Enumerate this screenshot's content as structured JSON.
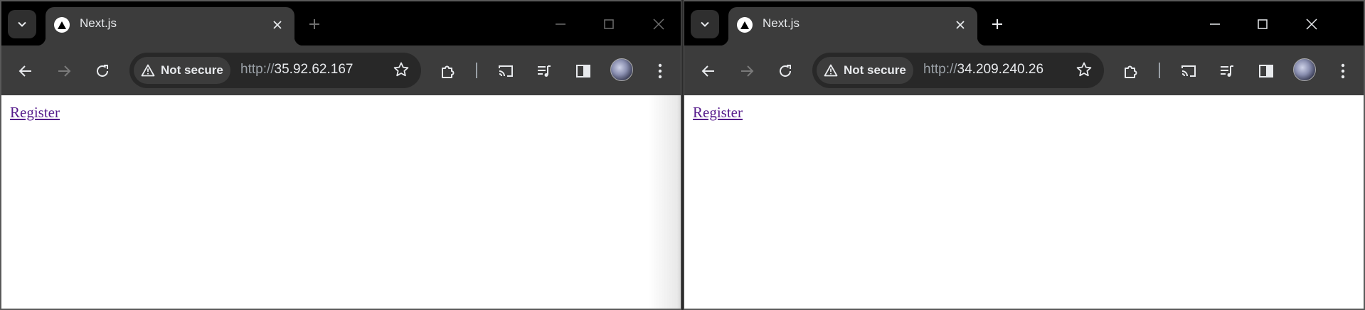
{
  "windows": [
    {
      "tab": {
        "title": "Next.js"
      },
      "address": {
        "security_label": "Not secure",
        "url_scheme": "http://",
        "url_host": "35.92.62.167"
      },
      "page": {
        "link_text": "Register"
      }
    },
    {
      "tab": {
        "title": "Next.js"
      },
      "address": {
        "security_label": "Not secure",
        "url_scheme": "http://",
        "url_host": "34.209.240.26"
      },
      "page": {
        "link_text": "Register"
      }
    }
  ],
  "icons": {
    "tab_search": "chevron-down-icon",
    "favicon": "nextjs-triangle-icon",
    "close": "close-icon",
    "new_tab": "plus-icon",
    "minimize": "minimize-icon",
    "maximize": "maximize-icon",
    "window_close": "window-close-icon",
    "back": "back-arrow-icon",
    "forward": "forward-arrow-icon",
    "reload": "reload-icon",
    "warning": "warning-triangle-icon",
    "bookmark": "star-icon",
    "extensions": "puzzle-icon",
    "cast": "cast-icon",
    "media": "media-queue-icon",
    "side_panel": "side-panel-icon",
    "profile": "avatar"
  },
  "colors": {
    "toolbar": "#3c3c3c",
    "tabstrip": "#000000",
    "link": "#551a8b",
    "text": "#e8eaed"
  }
}
